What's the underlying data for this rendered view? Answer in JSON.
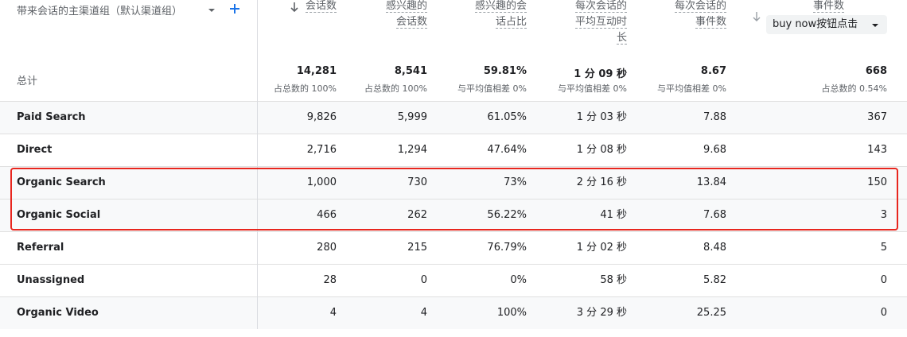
{
  "dimension": {
    "label": "带来会话的主渠道组（默认渠道组）",
    "dropdown_icon": "caret-down-icon",
    "add_icon": "plus-icon"
  },
  "columns": [
    {
      "line1": "会话数",
      "line2": "",
      "line3": "",
      "sorted": true
    },
    {
      "line1": "感兴趣的",
      "line2": "会话数",
      "line3": ""
    },
    {
      "line1": "感兴趣的会",
      "line2": "话占比",
      "line3": ""
    },
    {
      "line1": "每次会话的",
      "line2": "平均互动时",
      "line3": "长"
    },
    {
      "line1": "每次会话的",
      "line2": "事件数",
      "line3": ""
    },
    {
      "line1": "事件数",
      "line2": "",
      "line3": ""
    }
  ],
  "event_filter": {
    "value": "buy now按钮点击"
  },
  "totals": {
    "label": "总计",
    "values": [
      "14,281",
      "8,541",
      "59.81%",
      "1 分 09 秒",
      "8.67",
      "668"
    ],
    "subs": [
      "占总数的 100%",
      "占总数的 100%",
      "与平均值相差 0%",
      "与平均值相差 0%",
      "与平均值相差 0%",
      "占总数的 0.54%"
    ]
  },
  "rows": [
    {
      "name": "Paid Search",
      "values": [
        "9,826",
        "5,999",
        "61.05%",
        "1 分 03 秒",
        "7.88",
        "367"
      ]
    },
    {
      "name": "Direct",
      "values": [
        "2,716",
        "1,294",
        "47.64%",
        "1 分 08 秒",
        "9.68",
        "143"
      ]
    },
    {
      "name": "Organic Search",
      "values": [
        "1,000",
        "730",
        "73%",
        "2 分 16 秒",
        "13.84",
        "150"
      ]
    },
    {
      "name": "Organic Social",
      "values": [
        "466",
        "262",
        "56.22%",
        "41 秒",
        "7.68",
        "3"
      ]
    },
    {
      "name": "Referral",
      "values": [
        "280",
        "215",
        "76.79%",
        "1 分 02 秒",
        "8.48",
        "5"
      ]
    },
    {
      "name": "Unassigned",
      "values": [
        "28",
        "0",
        "0%",
        "58 秒",
        "5.82",
        "0"
      ]
    },
    {
      "name": "Organic Video",
      "values": [
        "4",
        "4",
        "100%",
        "3 分 29 秒",
        "25.25",
        "0"
      ]
    }
  ]
}
